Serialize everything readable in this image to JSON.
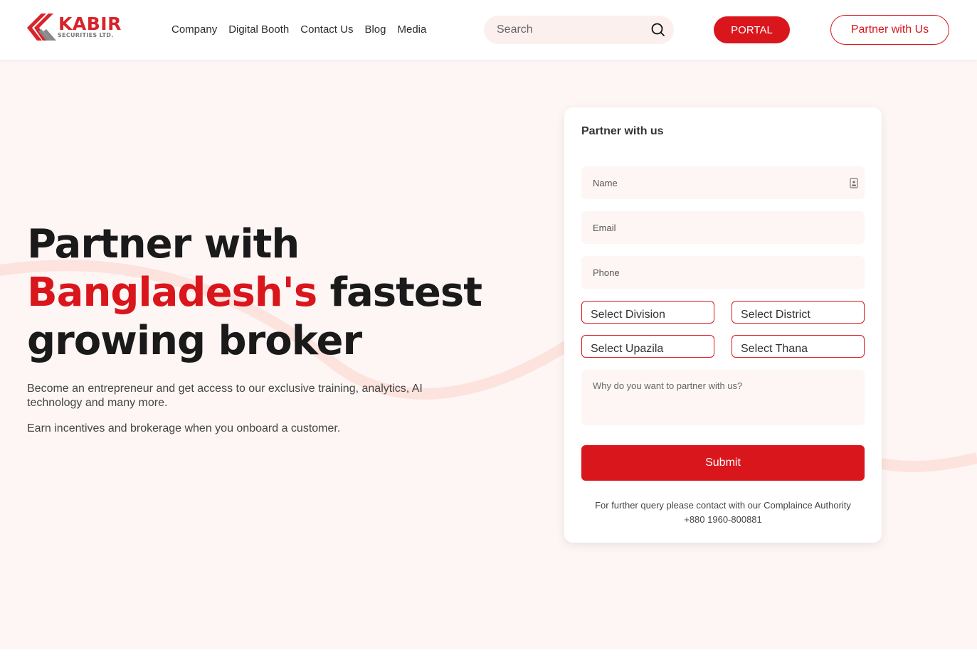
{
  "brand": {
    "name": "KABIR",
    "subtitle": "SECURITIES LTD.",
    "accent": "#d9161c"
  },
  "nav": {
    "items": [
      "Company",
      "Digital Booth",
      "Contact Us",
      "Blog",
      "Media"
    ]
  },
  "search": {
    "placeholder": "Search",
    "icon": "search-icon"
  },
  "header_buttons": {
    "portal": "PORTAL",
    "partner": "Partner with Us"
  },
  "hero": {
    "title_line1": "Partner with",
    "title_highlight": "Bangladesh's",
    "title_rest": " fastest",
    "title_line3": "growing broker",
    "paragraph1": "Become an entrepreneur and get access to our exclusive training, analytics, AI technology and many more.",
    "paragraph2": "Earn incentives and brokerage when you onboard a customer."
  },
  "form": {
    "title": "Partner with us",
    "name_placeholder": "Name",
    "email_placeholder": "Email",
    "phone_placeholder": "Phone",
    "select_division": "Select Division",
    "select_district": "Select District",
    "select_upazila": "Select Upazila",
    "select_thana": "Select Thana",
    "reason_placeholder": "Why do you want to partner with us?",
    "submit": "Submit",
    "note_line1": "For further query please contact with our Complaince Authority",
    "note_line2": "+880 1960-800881"
  }
}
